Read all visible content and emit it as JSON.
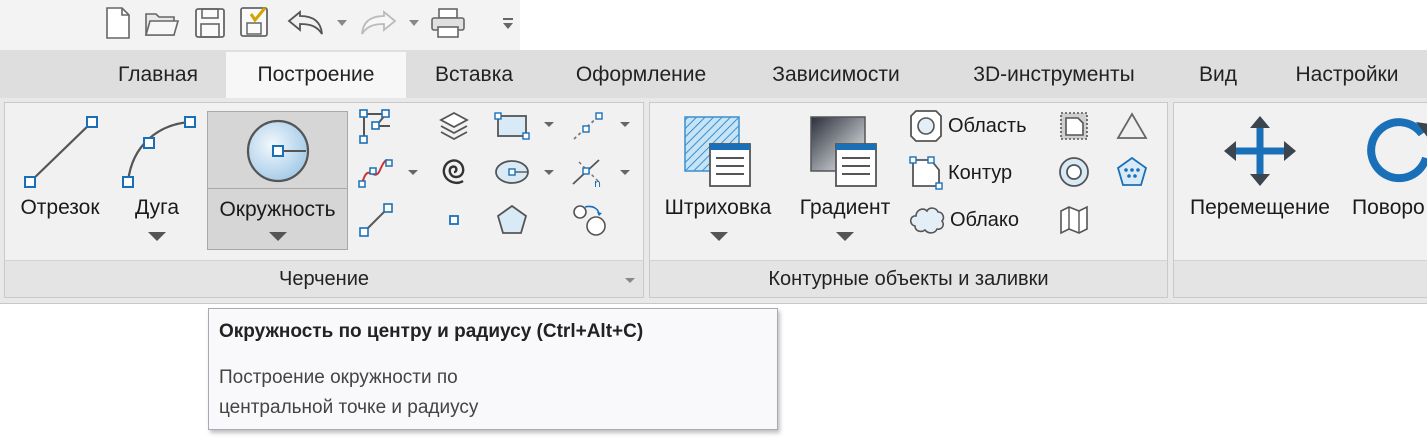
{
  "quick_access": {
    "icons": [
      "new-file-icon",
      "open-folder-icon",
      "save-icon",
      "save-all-icon",
      "undo-icon",
      "redo-icon",
      "print-icon",
      "customize-icon"
    ]
  },
  "tabs": [
    {
      "label": "Главная"
    },
    {
      "label": "Построение"
    },
    {
      "label": "Вставка"
    },
    {
      "label": "Оформление"
    },
    {
      "label": "Зависимости"
    },
    {
      "label": "3D-инструменты"
    },
    {
      "label": "Вид"
    },
    {
      "label": "Настройки"
    }
  ],
  "groups": {
    "drawing": {
      "title": "Черчение",
      "segment_label": "Отрезок",
      "arc_label": "Дуга",
      "circle_label": "Окружность"
    },
    "contour": {
      "title": "Контурные объекты и заливки",
      "hatch_label": "Штриховка",
      "gradient_label": "Градиент",
      "area_label": "Область",
      "contour_label": "Контур",
      "cloud_label": "Облако"
    },
    "edit": {
      "move_label": "Перемещение",
      "rotate_label": "Поворо"
    }
  },
  "tooltip": {
    "title": "Окружность по центру и радиусу (Ctrl+Alt+C)",
    "line1": "Построение окружности по",
    "line2": "центральной точке и радиусу"
  },
  "colors": {
    "accent": "#1a70b8",
    "ribbon": "#e8e8e8",
    "active_tab": "#f7f7f7"
  }
}
